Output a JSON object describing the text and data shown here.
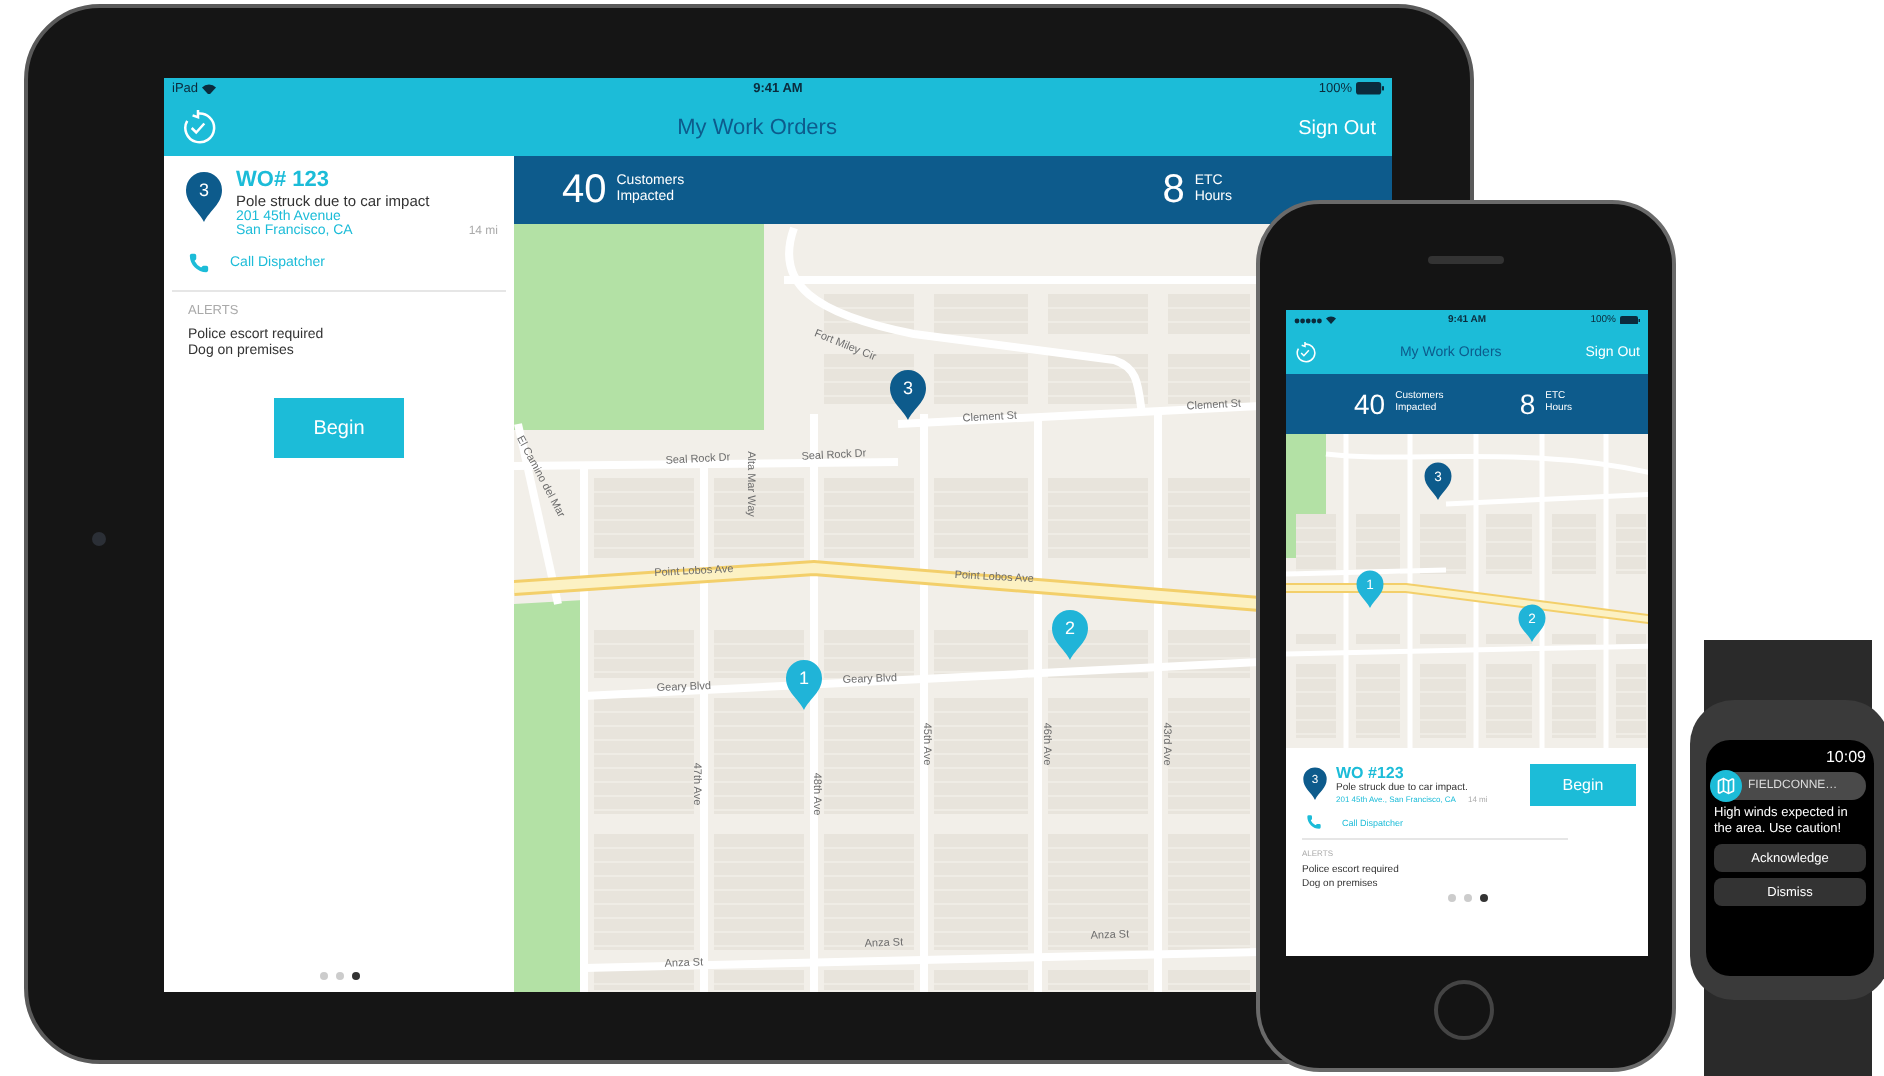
{
  "tablet": {
    "status_bar": {
      "carrier": "iPad",
      "time": "9:41 AM",
      "battery": "100%"
    },
    "nav": {
      "title": "My Work Orders",
      "action": "Sign Out"
    },
    "work_order": {
      "marker": "3",
      "number": "WO# 123",
      "description": "Pole struck due to car impact",
      "address_line_1": "201 45th Avenue",
      "address_line_2": "San Francisco, CA",
      "distance": "14 mi",
      "call": "Call Dispatcher"
    },
    "alerts": {
      "heading": "ALERTS",
      "items": [
        "Police escort required",
        "Dog on premises"
      ]
    },
    "primary_button": "Begin",
    "page_dots": [
      {
        "selected": false
      },
      {
        "selected": false
      },
      {
        "selected": true
      }
    ],
    "stats": [
      {
        "value": "40",
        "label_1": "Customers",
        "label_2": "Impacted"
      },
      {
        "value": "8",
        "label_1": "ETC",
        "label_2": "Hours"
      }
    ],
    "map": {
      "street_labels": [
        "Fort Miley Cir",
        "Clement St",
        "Clement St",
        "Seal Rock Dr",
        "Seal Rock Dr",
        "El Camino del Mar",
        "Point Lobos Ave",
        "Point Lobos Ave",
        "Geary Blvd",
        "Geary Blvd",
        "Alta Mar Way",
        "45th Ave",
        "46th Ave",
        "47th Ave",
        "48th Ave",
        "43rd Ave",
        "Anza St",
        "Anza St",
        "Anza St"
      ],
      "markers": [
        {
          "label": "3",
          "color": "#0d5b8c"
        },
        {
          "label": "2",
          "color": "#20b4d8"
        },
        {
          "label": "1",
          "color": "#20b4d8"
        }
      ]
    }
  },
  "phone": {
    "status_bar": {
      "time": "9:41 AM",
      "battery": "100%"
    },
    "nav": {
      "title": "My Work Orders",
      "action": "Sign Out"
    },
    "stats": [
      {
        "value": "40",
        "label_1": "Customers",
        "label_2": "Impacted"
      },
      {
        "value": "8",
        "label_1": "ETC",
        "label_2": "Hours"
      }
    ],
    "map": {
      "markers": [
        {
          "label": "3",
          "color": "#0d5b8c"
        },
        {
          "label": "1",
          "color": "#20b4d8"
        },
        {
          "label": "2",
          "color": "#20b4d8"
        }
      ]
    },
    "work_order": {
      "marker": "3",
      "number": "WO #123",
      "description": "Pole struck due to car impact.",
      "address": "201 45th Ave., San Francisco, CA",
      "distance": "14 mi",
      "call": "Call Dispatcher"
    },
    "primary_button": "Begin",
    "alerts": {
      "heading": "ALERTS",
      "items": [
        "Police escort required",
        "Dog on premises"
      ]
    },
    "page_dots": [
      {
        "selected": false
      },
      {
        "selected": false
      },
      {
        "selected": true
      }
    ]
  },
  "watch": {
    "time": "10:09",
    "app_name": "FIELDCONNE…",
    "message": "High winds expected in the area. Use caution!",
    "buttons": [
      "Acknowledge",
      "Dismiss"
    ]
  }
}
